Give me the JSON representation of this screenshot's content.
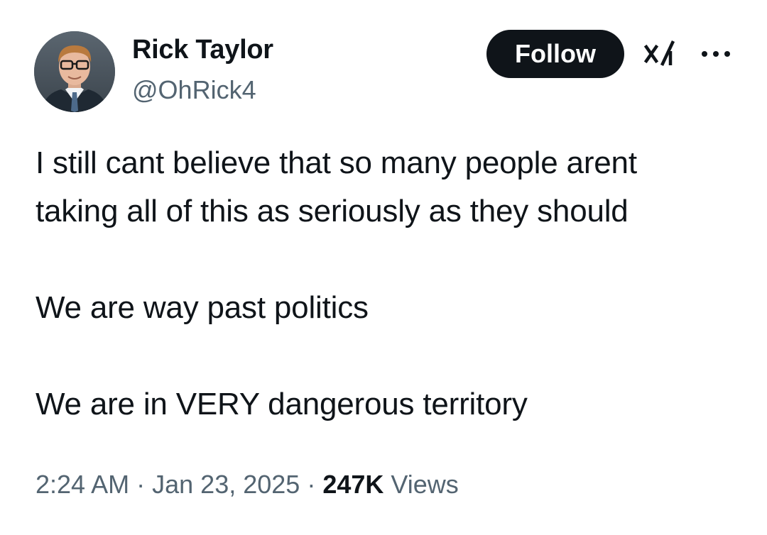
{
  "author": {
    "name": "Rick Taylor",
    "handle": "@OhRick4",
    "avatar_icon": "profile-photo"
  },
  "actions": {
    "follow_label": "Follow",
    "grok_icon": "grok-icon",
    "more_icon": "more-options-icon"
  },
  "tweet": {
    "lines": [
      "I still cant believe that so many people arent",
      "taking all of this as seriously as they should",
      "We are way past politics",
      "We are in VERY dangerous territory"
    ]
  },
  "meta": {
    "time": "2:24 AM",
    "separator": "·",
    "date": "Jan 23, 2025",
    "views_count": "247K",
    "views_label": "Views"
  },
  "colors": {
    "text": "#0f1419",
    "secondary": "#536471",
    "button_bg": "#0f1419",
    "button_text": "#ffffff",
    "background": "#ffffff"
  }
}
